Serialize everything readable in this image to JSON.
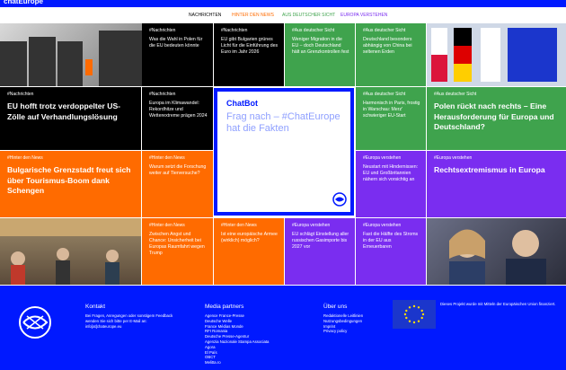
{
  "header": {
    "logo": "chatEurope"
  },
  "nav": {
    "items": [
      {
        "label": "NACHRICHTEN",
        "color": "#000000"
      },
      {
        "label": "HINTER DEN NEWS",
        "color": "#ff6b00"
      },
      {
        "label": "AUS DEUTSCHER SICHT",
        "color": "#3fa34d"
      },
      {
        "label": "EUROPA VERSTEHEN",
        "color": "#7a2df0"
      }
    ]
  },
  "tiles": {
    "r1c2": {
      "tag": "#Nachrichten",
      "text": "Was die Wahl in Polen für die EU bedeuten könnte"
    },
    "r1c3": {
      "tag": "#Nachrichten",
      "text": "EU gibt Bulgarien grünes Licht für die Einführung des Euro im Jahr 2026"
    },
    "r1c4": {
      "tag": "#Aus deutscher Sicht",
      "text": "Weniger Migration in die EU – doch Deutschland hält an Grenzkontrollen fest"
    },
    "r1c5": {
      "tag": "#Aus deutscher Sicht",
      "text": "Deutschland besonders abhängig von China bei seltenen Erden"
    },
    "r2c1": {
      "tag": "#Nachrichten",
      "text": "EU hofft trotz verdoppelter US-Zölle auf Verhandlungslösung"
    },
    "r2c2": {
      "tag": "#Nachrichten",
      "text": "Europa im Klimawandel: Rekordhitze und Wetterextreme prägen 2024"
    },
    "r2c5": {
      "tag": "#Aus deutscher Sicht",
      "text": "Harmonisch in Paris, frostig in Warschau: Merz' schwieriger EU-Start"
    },
    "r2c6": {
      "tag": "#Aus deutscher Sicht",
      "text": "Polen rückt nach rechts – Eine Herausforderung für Europa und Deutschland?"
    },
    "r3c1": {
      "tag": "#Hinter den News",
      "text": "Bulgarische Grenzstadt freut sich über Tourismus-Boom dank Schengen"
    },
    "r3c2": {
      "tag": "#Hinter den News",
      "text": "Warum setzt die Forschung weiter auf Tierversuche?"
    },
    "r3c5": {
      "tag": "#Europa verstehen",
      "text": "Neustart mit Hindernissen: EU und Großbritannien nähern sich vorsichtig an"
    },
    "r3c6": {
      "tag": "#Europa verstehen",
      "text": "Rechtsextremismus in Europa"
    },
    "r4c2": {
      "tag": "#Hinter den News",
      "text": "Zwischen Angst und Chance: Unsicherheit bei Europas Raumfahrt wegen Trump"
    },
    "r4c3": {
      "tag": "#Hinter den News",
      "text": "Ist eine europäische Armee (wirklich) möglich?"
    },
    "r4c4": {
      "tag": "#Europa verstehen",
      "text": "EU schlägt Einstellung aller russischen Gasimporte bis 2027 vor"
    },
    "r4c5": {
      "tag": "#Europa verstehen",
      "text": "Fast die Hälfte des Stroms in der EU aus Erneuerbaren"
    }
  },
  "chatbot": {
    "title": "ChatBot",
    "prompt": "Frag nach – #ChatEurope hat die Fakten"
  },
  "footer": {
    "kontakt_title": "Kontakt",
    "kontakt_text": "Bei Fragen, Anregungen oder sonstigem Feedback wenden Sie sich bitte per E-Mail an: info[at]chateurope.eu",
    "partners_title": "Media partners",
    "partners": [
      "Agence France-Presse",
      "Deutsche Welle",
      "France Médias Monde",
      "RFI Romania",
      "Deutsche Presse-Agentur",
      "Agenzia Nazionale Stampa Associata",
      "Agora",
      "El País",
      "OBCT",
      "Melitta.ro"
    ],
    "about_title": "Über uns",
    "about": [
      "Redaktionelle Leitlinien",
      "Nutzungsbedingungen",
      "Imprint",
      "Privacy policy"
    ],
    "eu_text": "Dieses Projekt wurde mit Mitteln der Europäischen Union finanziert."
  },
  "colors": {
    "brand_blue": "#0019ff",
    "green": "#3fa34d",
    "purple": "#7a2df0",
    "orange": "#ff6b00"
  }
}
